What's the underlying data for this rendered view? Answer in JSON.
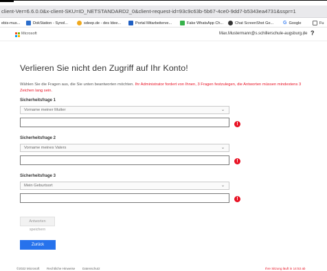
{
  "browser": {
    "address": "client-Ver=6.6.0.0&x-client-SKU=ID_NETSTANDARD2_0&client-request-id=93c9c63b-5b67-4ce0-9dd7-b5343ea4731&sspr=1",
    "bookmarks": [
      {
        "label": "ebis-mus...",
        "icon": "page-icon",
        "color": "#cccccc"
      },
      {
        "label": "DokStation - Synol...",
        "icon": "dokstation-icon",
        "color": "#2a6dcb"
      },
      {
        "label": "sdeep.de - des Idee...",
        "icon": "sdeep-icon",
        "color": "#f0a81c"
      },
      {
        "label": "Portal Mitarbeiterve...",
        "icon": "portal-icon",
        "color": "#1f5fc2"
      },
      {
        "label": "Fake WhatsApp Ch...",
        "icon": "whatsapp-icon",
        "color": "#36b24a"
      },
      {
        "label": "Chat ScreenShot Ge...",
        "icon": "chat-icon",
        "color": "#333333"
      },
      {
        "label": "Google",
        "icon": "google-icon",
        "color": "#4285f4"
      },
      {
        "label": "Fu",
        "icon": "doc-icon",
        "color": "#666666"
      }
    ]
  },
  "header": {
    "brand": "Microsoft",
    "user": "Max.Mustermann@s.schillerschule-augsburg.de",
    "separator": "|",
    "help": "?",
    "logo_colors": [
      "#f25022",
      "#7fba00",
      "#00a4ef",
      "#ffb900"
    ]
  },
  "main": {
    "title": "Verlieren Sie nicht den Zugriff auf Ihr Konto!",
    "description": "Wählen Sie die Fragen aus, die Sie unten beantworten möchten.",
    "description_red": "Ihr Administrator fordert von Ihnen, 3 Fragen festzulegen, die Antworten müssen mindestens 3 Zeichen lang sein.",
    "questions": [
      {
        "label": "Sicherheitsfrage 1",
        "selected": "Vorname meiner Mutter",
        "answer": ""
      },
      {
        "label": "Sicherheitsfrage 2",
        "selected": "Vorname meines Vaters",
        "answer": ""
      },
      {
        "label": "Sicherheitsfrage 3",
        "selected": "Mein Geburtsort",
        "answer": ""
      }
    ],
    "error_mark": "!",
    "dropdown_chevron": "⌄",
    "save_button": "Antworten speichern",
    "back_button": "Zurück"
  },
  "footer": {
    "copyright": "©2022 Microsoft",
    "links": [
      "Rechtliche Hinweise",
      "Datenschutz"
    ],
    "right": "Ihre Sitzung läuft in 14:53 ab"
  },
  "colors": {
    "accent": "#2672ec",
    "error": "#e81123"
  }
}
